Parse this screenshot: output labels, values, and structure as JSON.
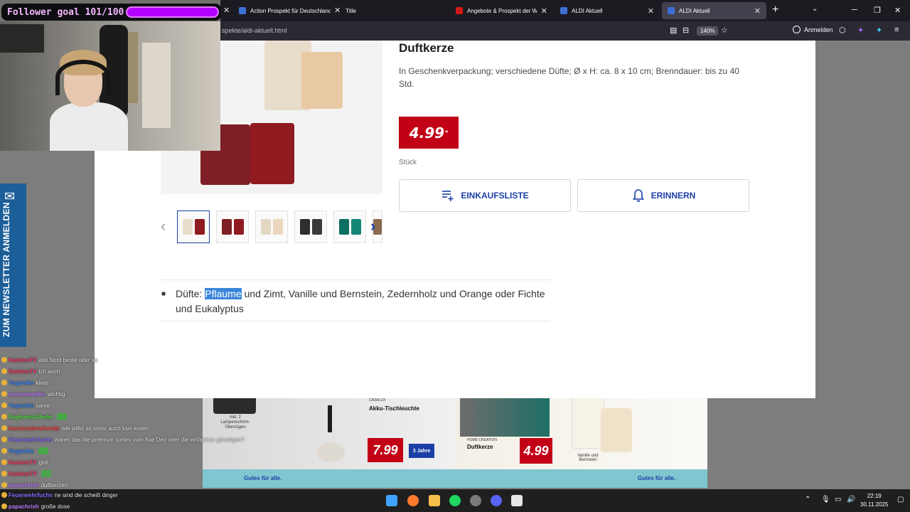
{
  "browser": {
    "tabs": [
      {
        "title": "Action Prospekt für Deutschland",
        "color": "#3d6fd4"
      },
      {
        "title": "Title",
        "color": "#3d6fd4"
      },
      {
        "title": "Angebote & Prospekt der Woche",
        "color": "#d31a1a"
      },
      {
        "title": "ALDI Aktuell",
        "color": "#3d6fd4"
      },
      {
        "title": "ALDI Aktuell",
        "color": "#3d6fd4"
      }
    ],
    "url": "spekte/aldi-aktuell.html",
    "zoom": "140%",
    "signin": "Anmelden"
  },
  "stream": {
    "follower_goal": "Follower goal 101/100"
  },
  "product": {
    "title": "Duftkerze",
    "description": "In Geschenkverpackung; verschiedene Düfte; Ø x H: ca. 8 x 10 cm; Brenndauer: bis zu 40 Std.",
    "price": "4.99",
    "price_mark": "*",
    "unit": "Stück",
    "btn_list": "EINKAUFSLISTE",
    "btn_remind": "ERINNERN",
    "scents_prefix": "Düfte: ",
    "scents_highlight": "Pflaume",
    "scents_rest": " und Zimt, Vanille und Bernstein, Zedernholz und Orange oder Fichte und Eukalyptus"
  },
  "newsletter": {
    "label": "ZUM NEWSLETTER ANMELDEN"
  },
  "flyer": {
    "left_brand": "CASALUX",
    "left_title": "Akku-Tischleuchte",
    "left_price": "7.99",
    "left_box": "inkl. 2 Lampenschirm-Überzügen",
    "left_guarantee": "3 Jahre",
    "right_brand": "HOME CREATION",
    "right_title": "Duftkerze",
    "right_price": "4.99",
    "right_scent": "Vanille und Bernstein",
    "footer": "Gutes für alle."
  },
  "chat": [
    {
      "name": "KaminoTV",
      "text": "aldi Nord beste oder so",
      "color": "#ff3b6b"
    },
    {
      "name": "KaminoTV",
      "text": "ich auch",
      "color": "#ff3b6b"
    },
    {
      "name": "Yuganiko",
      "text": "kiwis",
      "color": "#3d8bff"
    },
    {
      "name": "ameyenwelko",
      "text": "wichtig",
      "color": "#c07cff"
    },
    {
      "name": "Yuganiko",
      "text": "same",
      "color": "#3d8bff"
    },
    {
      "name": "RaphaelsAllerlei",
      "text": "",
      "color": "#57e04a"
    },
    {
      "name": "herrensahnehandy",
      "text": "wie willst so sonst auch kiwi essen",
      "color": "#ff4a4a"
    },
    {
      "name": "Feuerwehrfuchs",
      "text": "waren das die premium sorten vom Axe Deo oder die einfachen günstigen?",
      "color": "#8a6bff"
    },
    {
      "name": "Yuganiko",
      "text": "",
      "color": "#3d8bff"
    },
    {
      "name": "KaminoTV",
      "text": "geil",
      "color": "#ff3b6b"
    },
    {
      "name": "KaminoTV",
      "text": "",
      "color": "#ff3b6b"
    },
    {
      "name": "papachrish",
      "text": "duftkerzen",
      "color": "#c07cff"
    }
  ],
  "chat_bottom": [
    {
      "name": "Feuerwehrfuchs",
      "text": "ne sind die scheiß dinger",
      "color": "#8a6bff"
    },
    {
      "name": "papachrish",
      "text": "große dose",
      "color": "#c07cff"
    }
  ],
  "taskbar": {
    "time": "22:19",
    "date": "30.11.2025"
  }
}
